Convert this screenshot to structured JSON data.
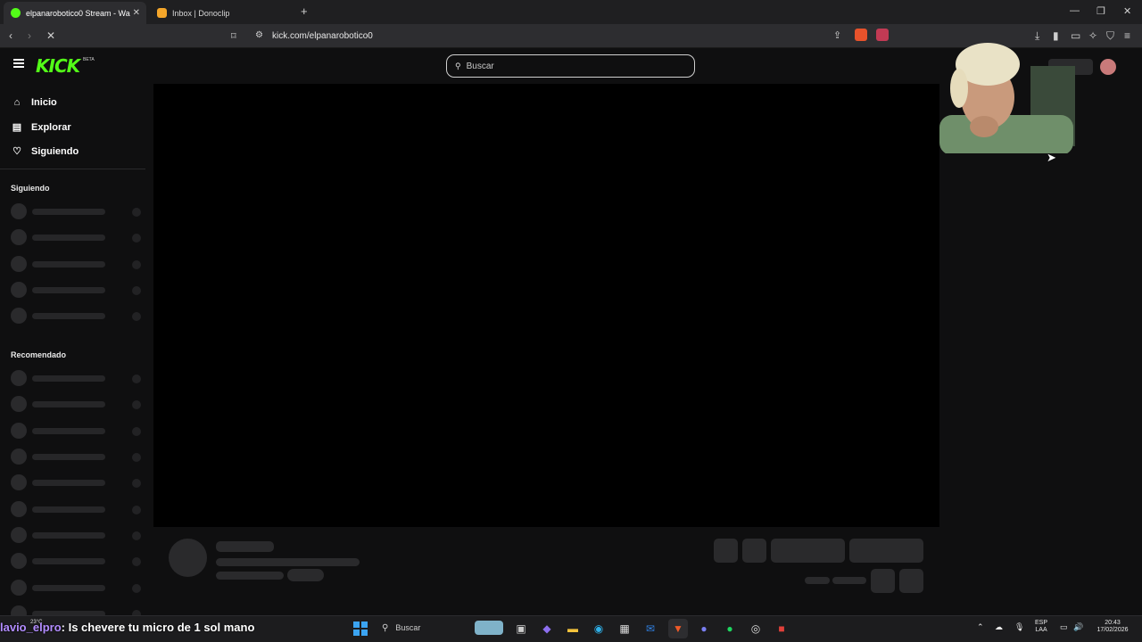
{
  "browser": {
    "tabs": [
      {
        "label": "elpanarobotico0 Stream - Wa",
        "active": true
      },
      {
        "label": "Inbox | Donoclip",
        "active": false
      }
    ],
    "url": "kick.com/elpanarobotico0"
  },
  "kick": {
    "logo": "KICK",
    "beta": "BETA",
    "search_placeholder": "Buscar",
    "accent": "#53fc18"
  },
  "sidebar": {
    "nav": [
      {
        "label": "Inicio",
        "icon": "home-icon"
      },
      {
        "label": "Explorar",
        "icon": "browse-icon"
      },
      {
        "label": "Siguiendo",
        "icon": "heart-icon"
      }
    ],
    "following_heading": "Siguiendo",
    "recommended_heading": "Recomendado"
  },
  "overlay": {
    "chat_user": "lavio_elpro",
    "chat_message": ": Is chevere tu micro de 1 sol mano"
  },
  "taskbar": {
    "search_placeholder": "Buscar",
    "weather": "23°C",
    "language": "ESP",
    "layout": "LAA",
    "time": "20:43",
    "date": "17/02/2026"
  }
}
